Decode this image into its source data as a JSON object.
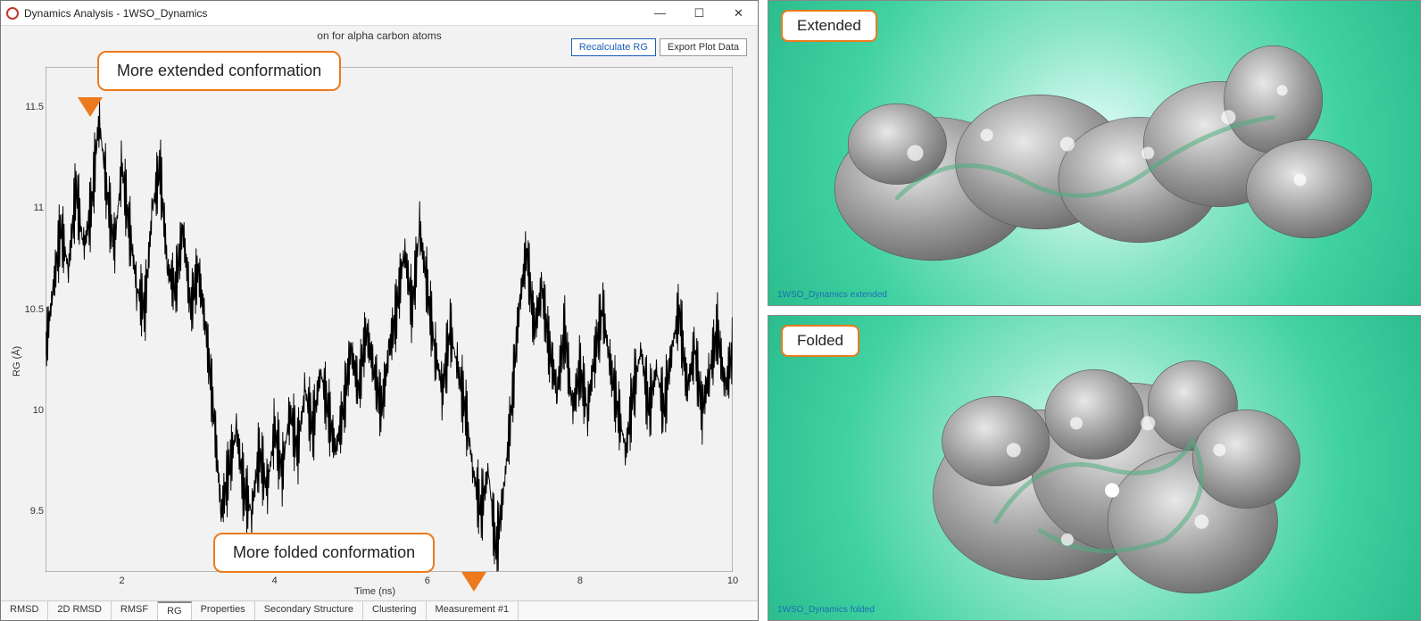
{
  "window": {
    "title": "Dynamics Analysis - 1WSO_Dynamics",
    "minimize_glyph": "—",
    "maximize_glyph": "☐",
    "close_glyph": "✕"
  },
  "chart_header": {
    "title_fragment": "on for alpha carbon atoms",
    "btn_recalc": "Recalculate RG",
    "btn_export": "Export Plot Data"
  },
  "callouts": {
    "extended": "More extended conformation",
    "folded": "More folded conformation"
  },
  "tabs": [
    "RMSD",
    "2D RMSD",
    "RMSF",
    "RG",
    "Properties",
    "Secondary Structure",
    "Clustering",
    "Measurement #1"
  ],
  "active_tab_index": 3,
  "chart_data": {
    "type": "line",
    "title": "Radius of gyration for alpha carbon atoms",
    "xlabel": "Time (ns)",
    "ylabel": "RG (Å)",
    "xlim": [
      1,
      10
    ],
    "ylim": [
      9.2,
      11.7
    ],
    "xticks": [
      2,
      4,
      6,
      8,
      10
    ],
    "yticks": [
      9.5,
      10,
      10.5,
      11,
      11.5
    ],
    "series": [
      {
        "name": "RG",
        "x": [
          1.0,
          1.1,
          1.2,
          1.3,
          1.4,
          1.5,
          1.6,
          1.7,
          1.8,
          1.9,
          2.0,
          2.1,
          2.2,
          2.3,
          2.4,
          2.5,
          2.6,
          2.7,
          2.8,
          2.9,
          3.0,
          3.1,
          3.2,
          3.3,
          3.4,
          3.5,
          3.6,
          3.7,
          3.8,
          3.9,
          4.0,
          4.1,
          4.2,
          4.3,
          4.4,
          4.5,
          4.6,
          4.7,
          4.8,
          4.9,
          5.0,
          5.1,
          5.2,
          5.3,
          5.4,
          5.5,
          5.6,
          5.7,
          5.8,
          5.9,
          6.0,
          6.1,
          6.2,
          6.3,
          6.4,
          6.5,
          6.6,
          6.7,
          6.8,
          6.9,
          7.0,
          7.1,
          7.2,
          7.3,
          7.4,
          7.5,
          7.6,
          7.7,
          7.8,
          7.9,
          8.0,
          8.1,
          8.2,
          8.3,
          8.4,
          8.5,
          8.6,
          8.7,
          8.8,
          8.9,
          9.0,
          9.1,
          9.2,
          9.3,
          9.4,
          9.5,
          9.6,
          9.7,
          9.8,
          9.9,
          10.0
        ],
        "values": [
          10.3,
          10.6,
          10.9,
          10.7,
          11.1,
          10.8,
          11.0,
          11.45,
          11.1,
          10.8,
          11.2,
          10.9,
          10.6,
          10.5,
          11.0,
          11.2,
          10.7,
          10.6,
          10.9,
          10.5,
          10.7,
          10.4,
          10.0,
          9.5,
          9.7,
          9.9,
          9.6,
          9.5,
          9.8,
          9.6,
          9.9,
          9.7,
          10.0,
          9.8,
          10.1,
          9.9,
          10.2,
          10.0,
          9.8,
          10.0,
          10.3,
          10.1,
          10.4,
          10.2,
          10.0,
          10.3,
          10.5,
          10.8,
          10.5,
          10.9,
          10.6,
          10.3,
          10.1,
          10.4,
          10.2,
          10.0,
          9.7,
          9.5,
          9.7,
          9.3,
          9.6,
          10.0,
          10.5,
          10.8,
          10.4,
          10.6,
          10.3,
          10.1,
          10.4,
          10.0,
          10.2,
          10.0,
          10.3,
          10.5,
          10.2,
          10.0,
          9.8,
          10.1,
          10.3,
          10.0,
          10.2,
          10.0,
          10.3,
          10.5,
          10.1,
          10.3,
          10.0,
          10.2,
          10.4,
          10.1,
          10.3
        ]
      }
    ]
  },
  "right": {
    "extended": {
      "label": "Extended",
      "caption": "1WSO_Dynamics extended"
    },
    "folded": {
      "label": "Folded",
      "caption": "1WSO_Dynamics folded"
    }
  }
}
